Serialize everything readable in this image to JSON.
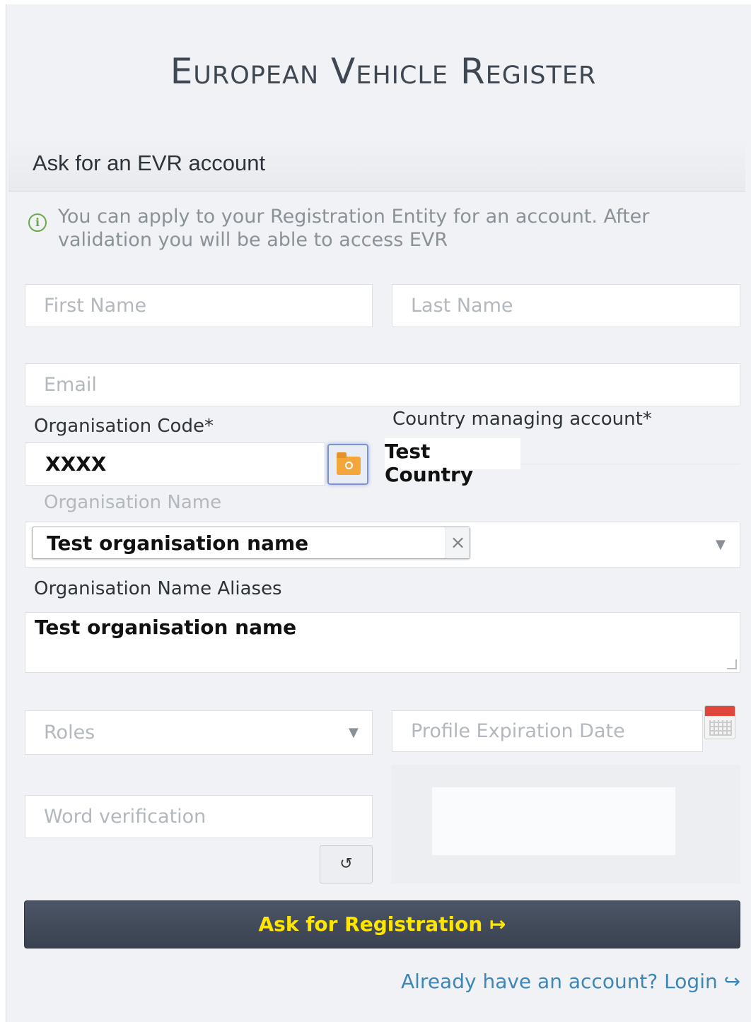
{
  "header": {
    "title": "European Vehicle Register"
  },
  "section": {
    "heading": "Ask for an EVR account"
  },
  "info": {
    "line1": "You can apply to your Registration Entity for an account. After",
    "line2": "validation you will be able to access EVR"
  },
  "form": {
    "first_name_placeholder": "First Name",
    "last_name_placeholder": "Last Name",
    "email_placeholder": "Email",
    "org_code_label": "Organisation Code*",
    "org_code_value": "XXXX",
    "country_label": "Country managing account*",
    "country_value": "Test Country",
    "org_name_label": "Organisation Name",
    "org_name_value": "Test organisation name",
    "org_name_remove": "×",
    "org_aliases_label": "Organisation Name Aliases",
    "org_aliases_value": "Test organisation name",
    "roles_placeholder": "Roles",
    "expiration_placeholder": "Profile Expiration Date",
    "word_verification_placeholder": "Word verification",
    "refresh_symbol": "↺",
    "caret": "▼"
  },
  "actions": {
    "submit_label": "Ask for Registration ↦",
    "login_link": "Already have an account? Login ↪"
  }
}
